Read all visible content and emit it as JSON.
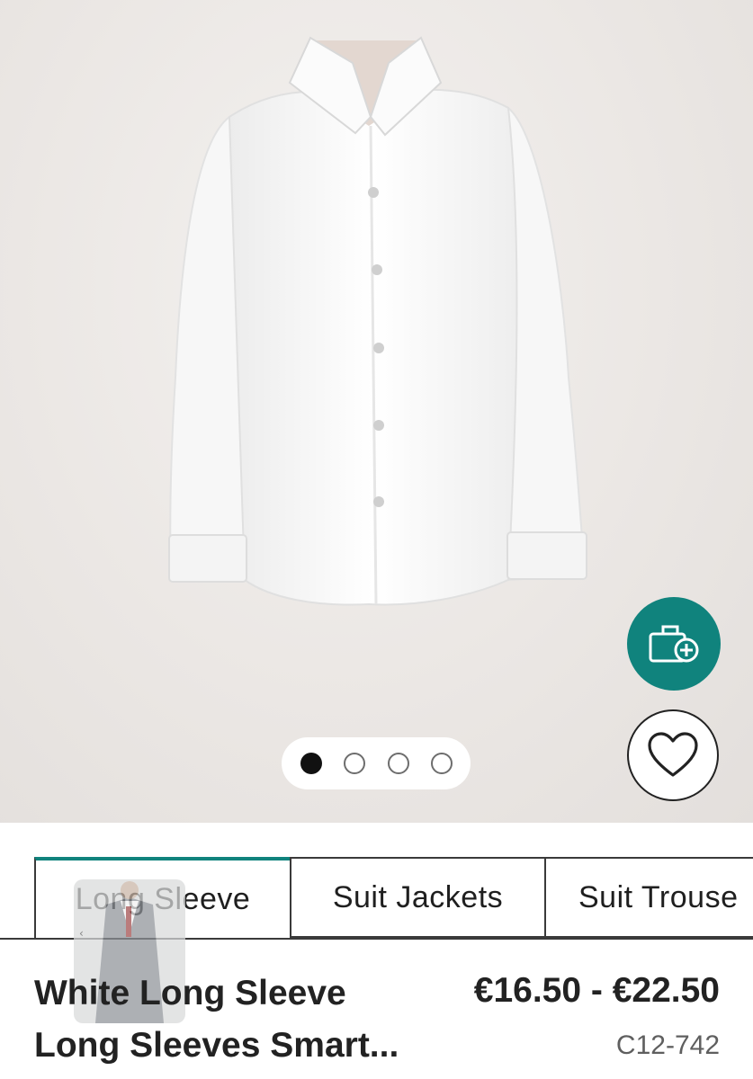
{
  "product": {
    "image_alt": "White long sleeve shirt",
    "title_line1": "White Long Sleeve",
    "title_line2": "Long Sleeves Smart...",
    "price": "€16.50 - €22.50",
    "code": "C12-742"
  },
  "gallery": {
    "total_images": 4,
    "current_index": 1
  },
  "actions": {
    "add_to_bag_icon": "bag-plus-icon",
    "wishlist_icon": "heart-outline-icon"
  },
  "tabs": [
    {
      "label": "Long Sleeve",
      "active": true
    },
    {
      "label": "Suit Jackets",
      "active": false
    },
    {
      "label": "Suit Trouse",
      "active": false
    }
  ],
  "colors": {
    "accent": "#10837d",
    "text": "#222222",
    "muted": "#5f5f5f"
  }
}
